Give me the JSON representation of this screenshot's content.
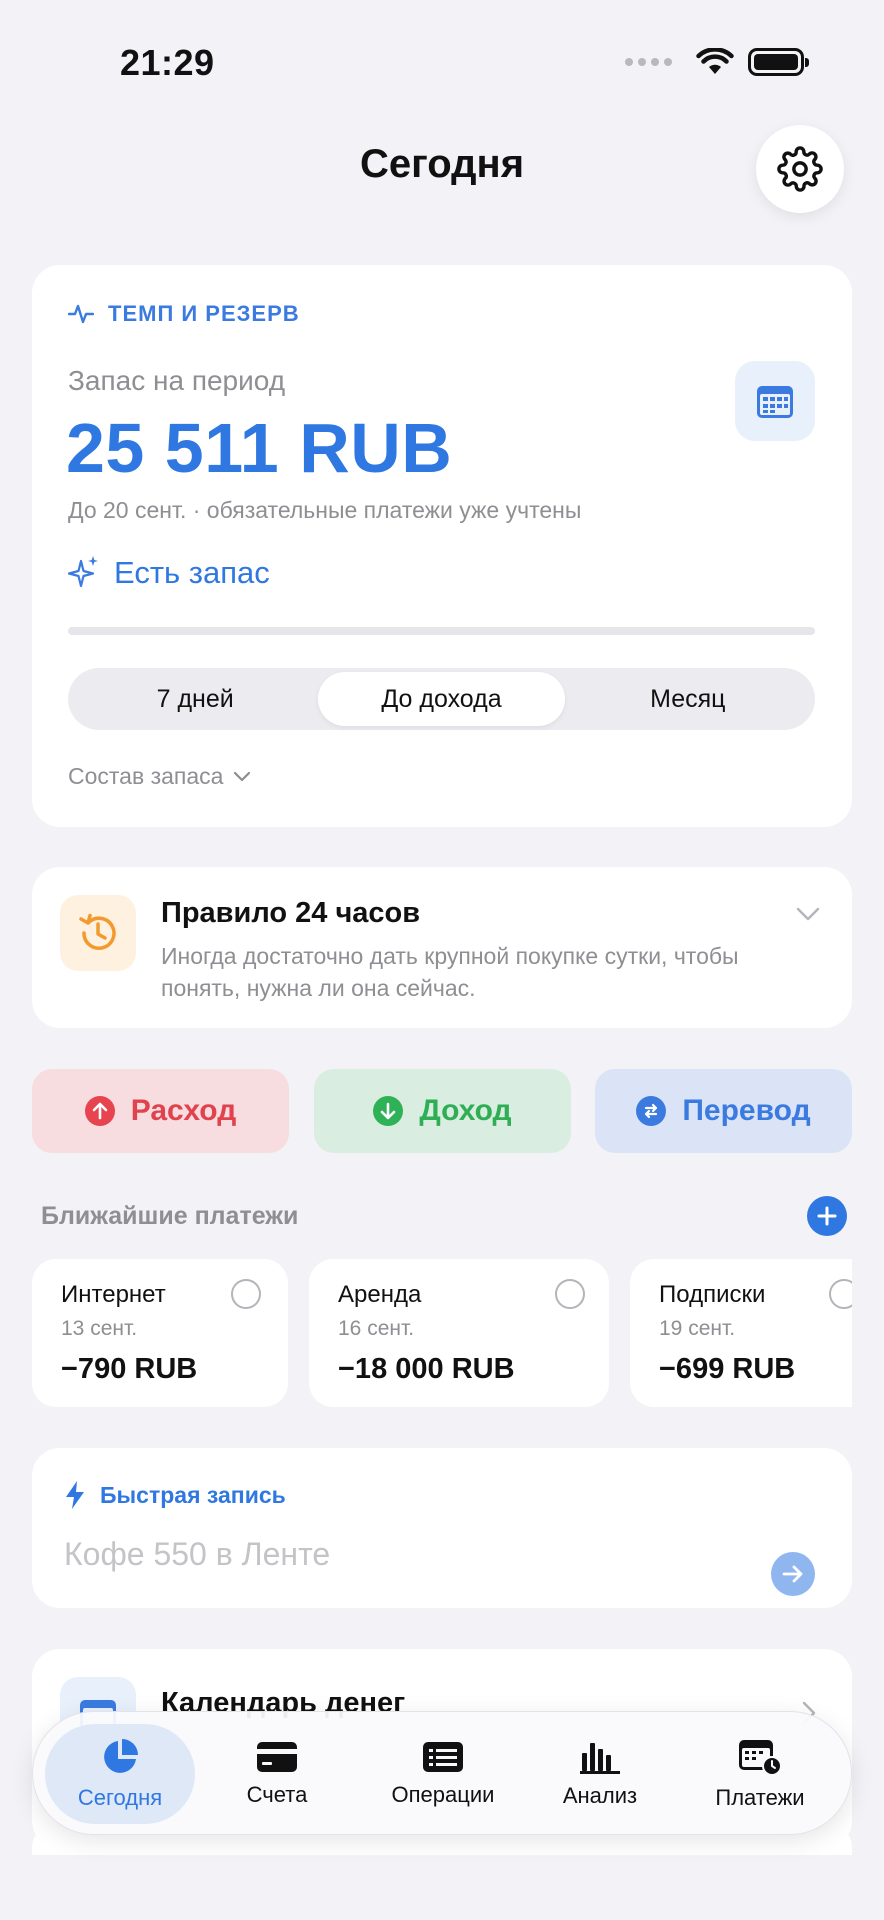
{
  "status_bar": {
    "time": "21:29"
  },
  "header": {
    "title": "Сегодня"
  },
  "reserve": {
    "tag": "ТЕМП И РЕЗЕРВ",
    "label": "Запас на период",
    "amount": "25 511 RUB",
    "note": "До 20 сент. · обязательные платежи уже учтены",
    "status": "Есть запас",
    "progress": 0,
    "periods": [
      "7 дней",
      "До дохода",
      "Месяц"
    ],
    "selected_period": "До дохода",
    "breakdown_label": "Состав запаса"
  },
  "rule": {
    "title": "Правило 24 часов",
    "text": "Иногда достаточно дать крупной покупке сутки, чтобы понять, нужна ли она сейчас."
  },
  "actions": {
    "expense": "Расход",
    "income": "Доход",
    "transfer": "Перевод"
  },
  "upcoming": {
    "title": "Ближайшие платежи",
    "items": [
      {
        "name": "Интернет",
        "date": "13 сент.",
        "amount": "−790 RUB"
      },
      {
        "name": "Аренда",
        "date": "16 сент.",
        "amount": "−18 000 RUB"
      },
      {
        "name": "Подписки",
        "date": "19 сент.",
        "amount": "−699 RUB"
      }
    ]
  },
  "quick_entry": {
    "title": "Быстрая запись",
    "placeholder": "Кофе 550 в Ленте"
  },
  "calendar_card": {
    "title": "Календарь денег"
  },
  "tabbar": {
    "tabs": [
      {
        "label": "Сегодня",
        "icon": "pie-chart-icon"
      },
      {
        "label": "Счета",
        "icon": "card-icon"
      },
      {
        "label": "Операции",
        "icon": "list-icon"
      },
      {
        "label": "Анализ",
        "icon": "bar-chart-icon"
      },
      {
        "label": "Платежи",
        "icon": "calendar-clock-icon"
      }
    ],
    "active": "Сегодня"
  },
  "colors": {
    "accent": "#2f78e1",
    "expense": "#e0434e",
    "income": "#2fae55",
    "background": "#f2f2f7"
  }
}
